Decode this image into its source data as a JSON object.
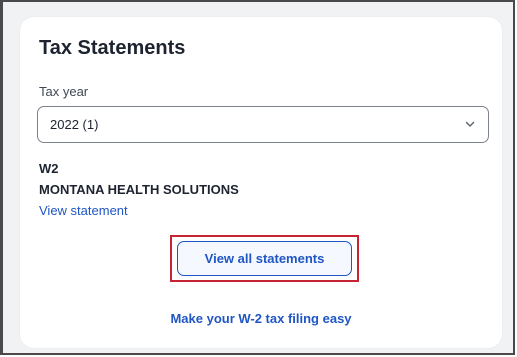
{
  "card": {
    "title": "Tax Statements",
    "tax_year_label": "Tax year",
    "tax_year_value": "2022 (1)",
    "statement": {
      "form_type": "W2",
      "employer": "MONTANA HEALTH SOLUTIONS",
      "view_link": "View statement"
    },
    "view_all_button": "View all statements",
    "footer_link": "Make your W-2 tax filing easy"
  },
  "colors": {
    "accent": "#1f56c4",
    "highlight": "#c72433",
    "text": "#1d2430"
  },
  "icons": {
    "select_arrow": "chevron-down-icon"
  }
}
